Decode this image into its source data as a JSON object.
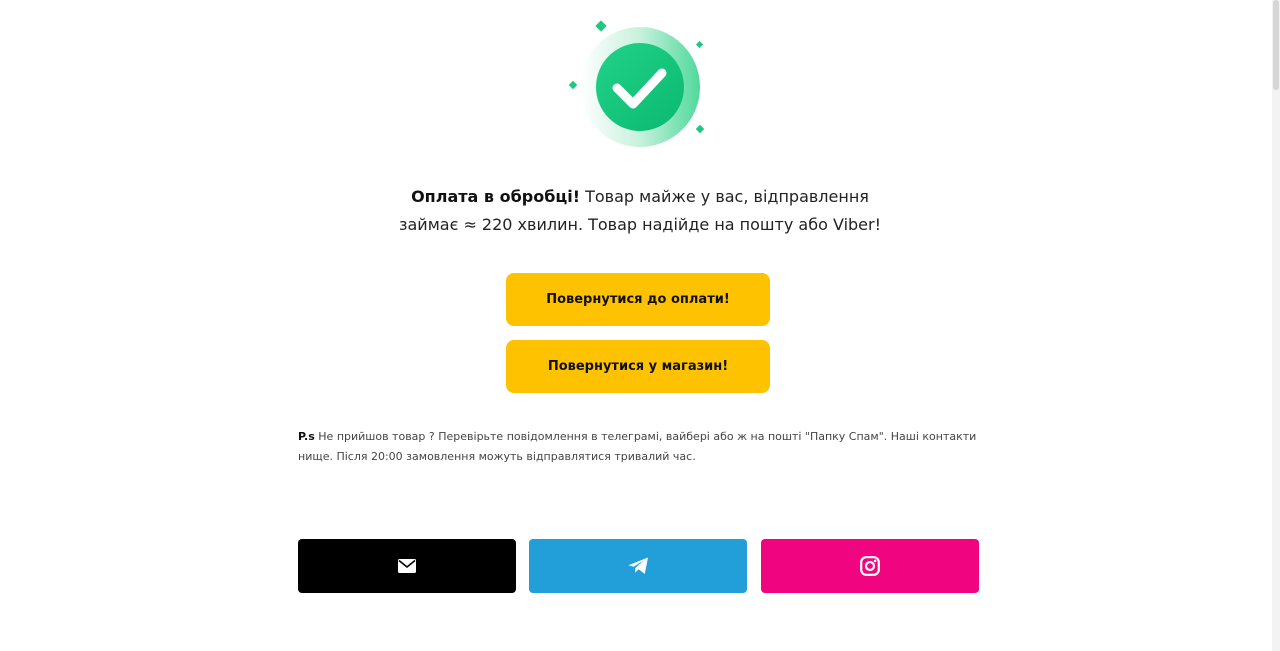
{
  "status": {
    "title": "Оплата в обробці!",
    "text": " Товар майже у вас, відправлення займає ≈ 220 хвилин. Товар надійде на пошту або Viber!"
  },
  "buttons": {
    "back_to_payment": "Повернутися до оплати!",
    "back_to_shop": "Повернутися у магазин!"
  },
  "note": {
    "label": "P.s",
    "text": " Не прийшов товар ? Перевірьте повідомлення в телеграмі, вайбері або ж на пошті \"Папку Спам\". Наші контакти нище. Після 20:00 замовлення можуть відправлятися тривалий час."
  },
  "contacts": [
    {
      "icon": "email-icon",
      "color": "#000000"
    },
    {
      "icon": "telegram-icon",
      "color": "#229ed9"
    },
    {
      "icon": "instagram-icon",
      "color": "#f0047f"
    }
  ],
  "colors": {
    "accent_yellow": "#ffc200",
    "success_green": "#0fc27a"
  }
}
